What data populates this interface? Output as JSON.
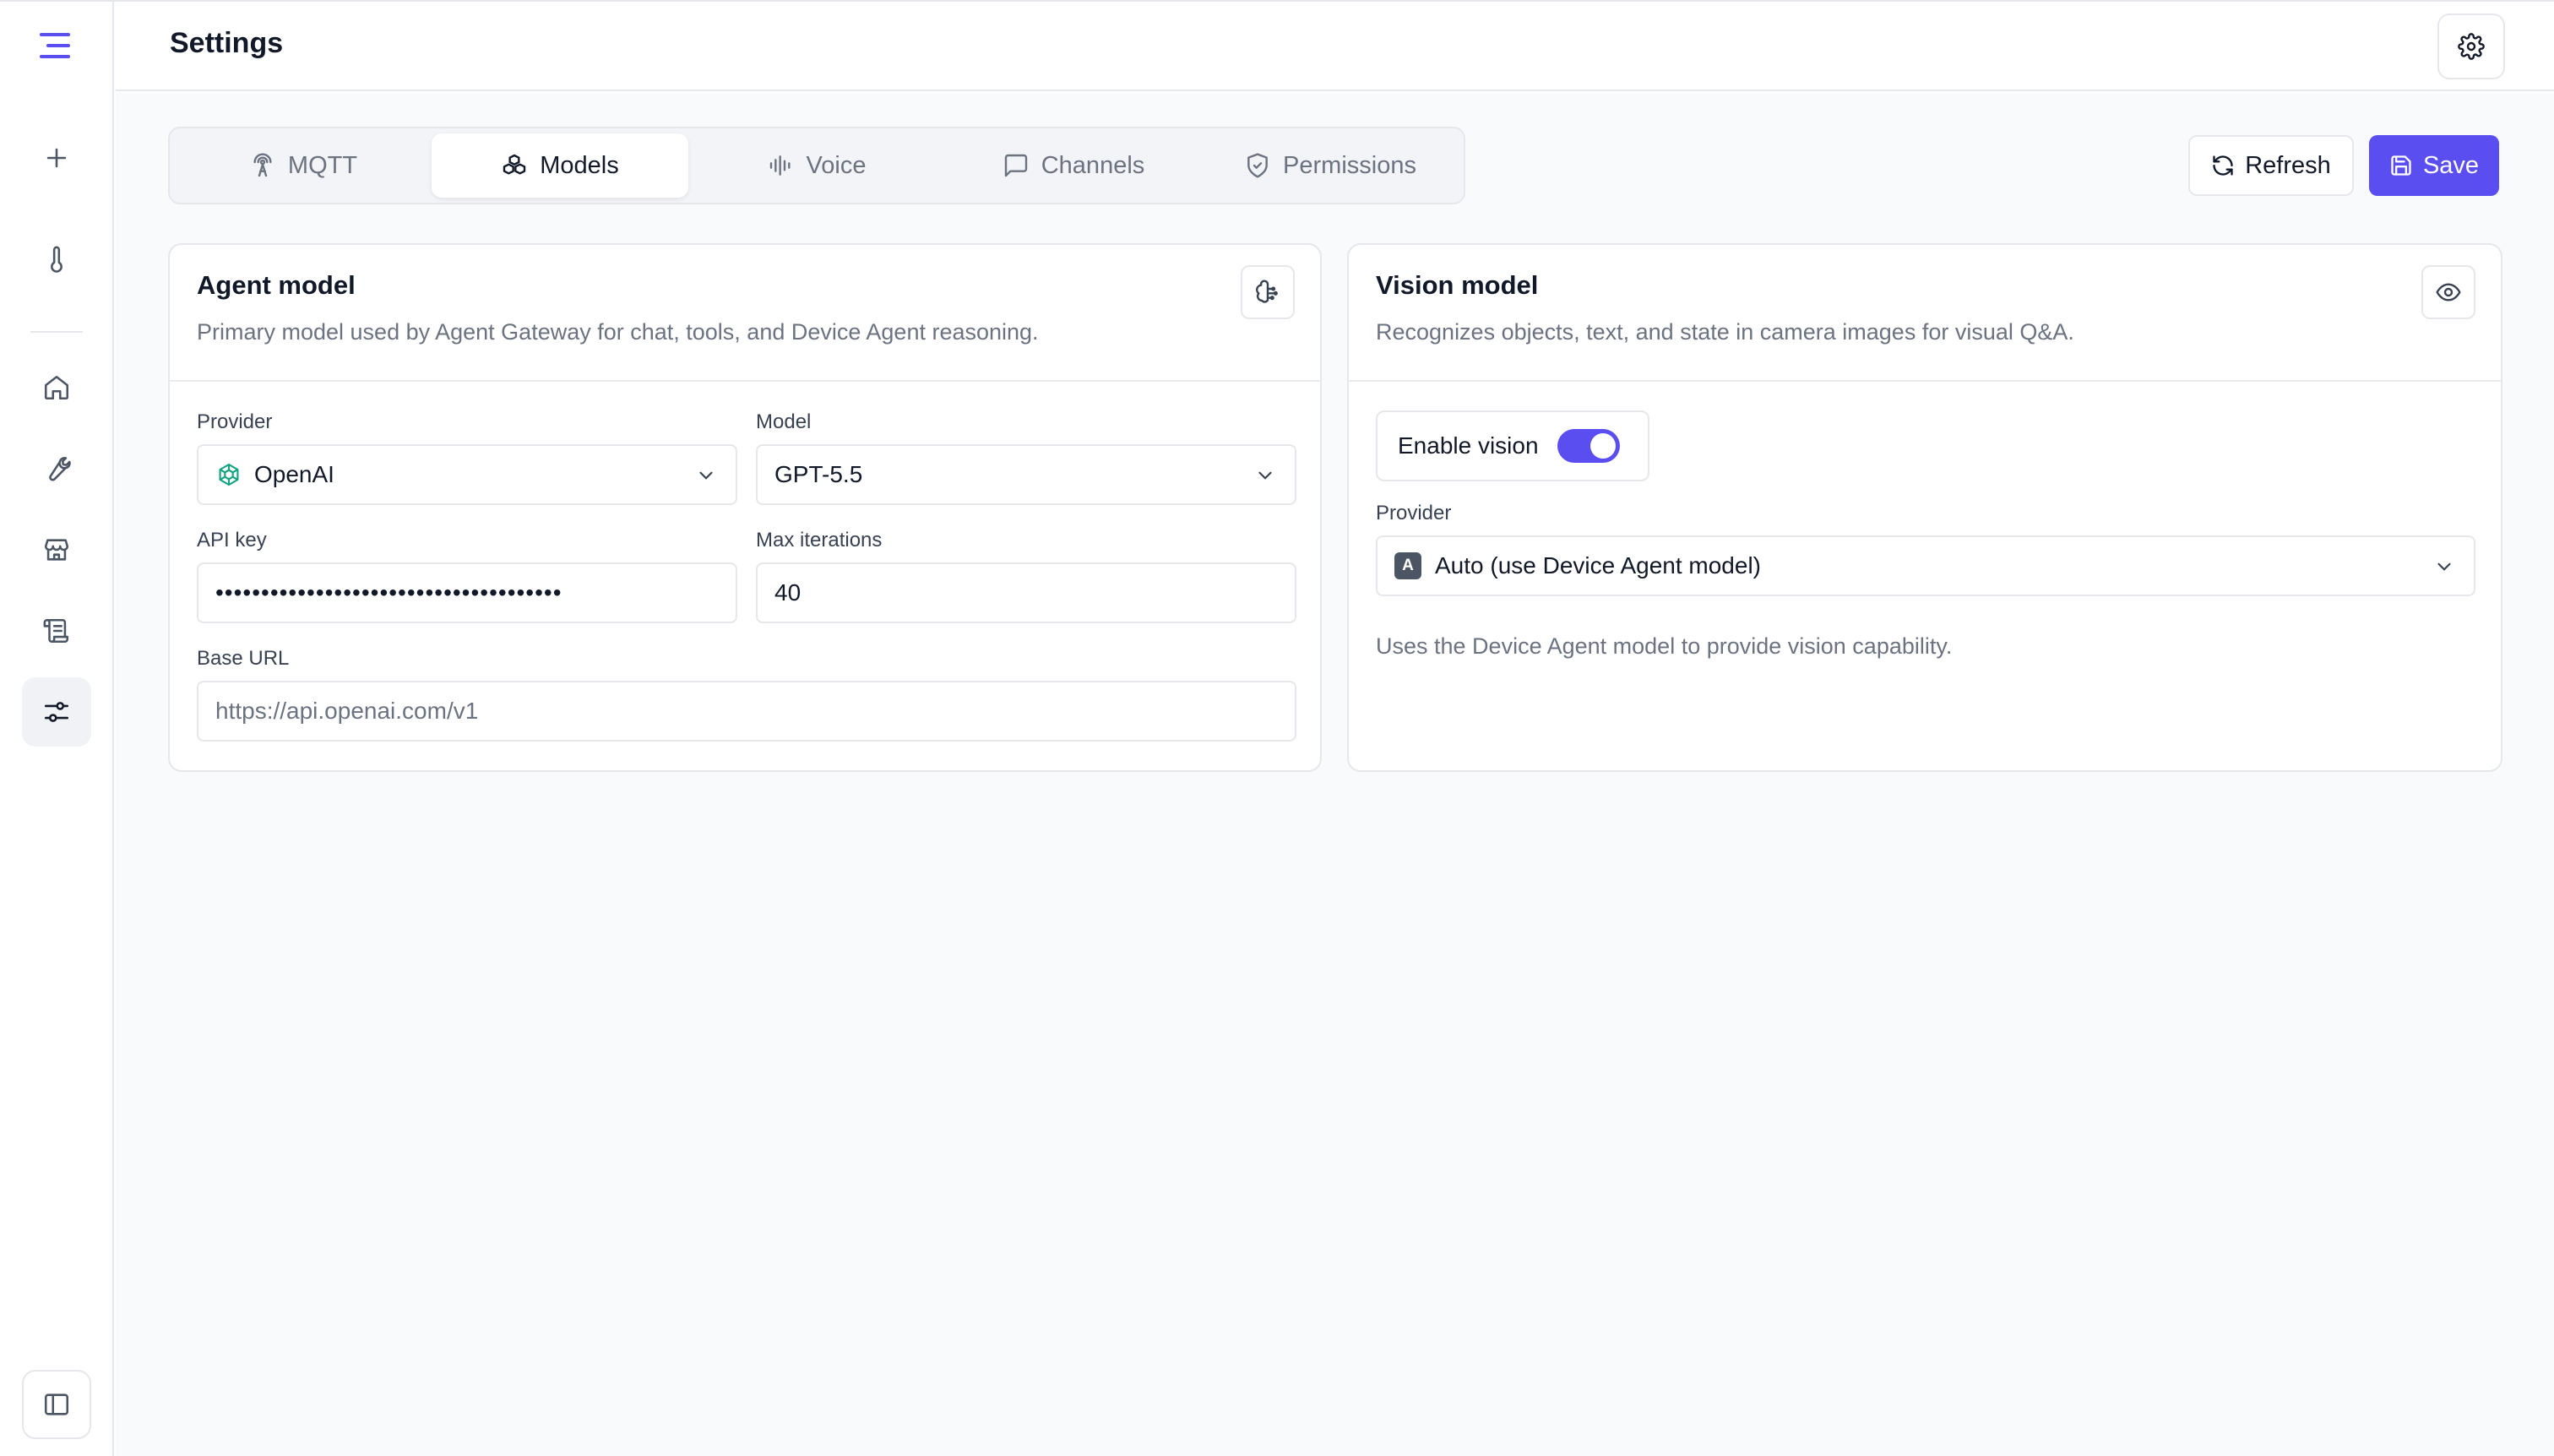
{
  "header": {
    "title": "Settings"
  },
  "tabs": [
    {
      "label": "MQTT",
      "icon": "radio-tower-icon"
    },
    {
      "label": "Models",
      "icon": "boxes-icon",
      "active": true
    },
    {
      "label": "Voice",
      "icon": "audio-waveform-icon"
    },
    {
      "label": "Channels",
      "icon": "message-square-icon"
    },
    {
      "label": "Permissions",
      "icon": "shield-check-icon"
    }
  ],
  "actions": {
    "refresh_label": "Refresh",
    "save_label": "Save"
  },
  "agent": {
    "title": "Agent model",
    "description": "Primary model used by Agent Gateway for chat, tools, and Device Agent reasoning.",
    "provider_label": "Provider",
    "provider_value": "OpenAI",
    "model_label": "Model",
    "model_value": "GPT-5.5",
    "api_key_label": "API key",
    "api_key_value": "••••••••••••••••••••••••••••••••••••••",
    "max_iterations_label": "Max iterations",
    "max_iterations_value": "40",
    "base_url_label": "Base URL",
    "base_url_value": "https://api.openai.com/v1"
  },
  "vision": {
    "title": "Vision model",
    "description": "Recognizes objects, text, and state in camera images for visual Q&A.",
    "enable_label": "Enable vision",
    "enabled": true,
    "provider_label": "Provider",
    "provider_badge": "A",
    "provider_value": "Auto (use Device Agent model)",
    "help": "Uses the Device Agent model to provide vision capability."
  },
  "colors": {
    "accent": "#5b4ef0",
    "border": "#e5e7eb",
    "muted_text": "#6b7280",
    "openai_green": "#10a37f"
  }
}
